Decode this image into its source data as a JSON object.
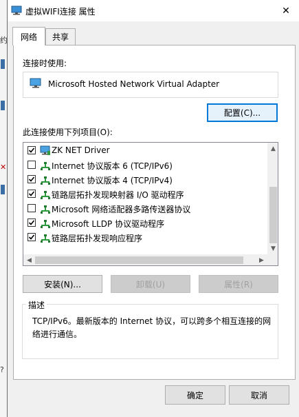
{
  "window": {
    "title": "虚拟WIFI连接 属性",
    "close_glyph": "✕"
  },
  "background": {
    "chars": [
      "约",
      "I",
      "I",
      "I",
      "l",
      "lo",
      "ly",
      "?"
    ]
  },
  "tabs": [
    {
      "label": "网络",
      "active": true
    },
    {
      "label": "共享",
      "active": false
    }
  ],
  "connect_using": {
    "label": "连接时使用:",
    "adapter": "Microsoft Hosted Network Virtual Adapter",
    "configure_button": "配置(C)..."
  },
  "items": {
    "label": "此连接使用下列项目(O):",
    "rows": [
      {
        "text": "ZK NET Driver",
        "checked": true,
        "icon": "monitor-icon"
      },
      {
        "text": "Internet 协议版本 6 (TCP/IPv6)",
        "checked": false,
        "icon": "network-protocol-icon"
      },
      {
        "text": "Internet 协议版本 4 (TCP/IPv4)",
        "checked": true,
        "icon": "network-protocol-icon"
      },
      {
        "text": "链路层拓扑发现映射器 I/O 驱动程序",
        "checked": true,
        "icon": "network-protocol-icon"
      },
      {
        "text": "Microsoft 网络适配器多路传送器协议",
        "checked": false,
        "icon": "network-protocol-icon"
      },
      {
        "text": "Microsoft LLDP 协议驱动程序",
        "checked": true,
        "icon": "network-protocol-icon"
      },
      {
        "text": "链路层拓扑发现响应程序",
        "checked": true,
        "icon": "network-protocol-icon"
      }
    ]
  },
  "actions": {
    "install": "安装(N)...",
    "uninstall": "卸载(U)",
    "properties": "属性(R)"
  },
  "description": {
    "legend": "描述",
    "text": "TCP/IPv6。最新版本的 Internet 协议，可以跨多个相互连接的网络进行通信。"
  },
  "footer": {
    "ok": "确定",
    "cancel": "取消"
  },
  "colors": {
    "accent": "#0078d7",
    "dialog_bg": "#f0f0f0",
    "protocol_icon": "#2e9a3e"
  }
}
